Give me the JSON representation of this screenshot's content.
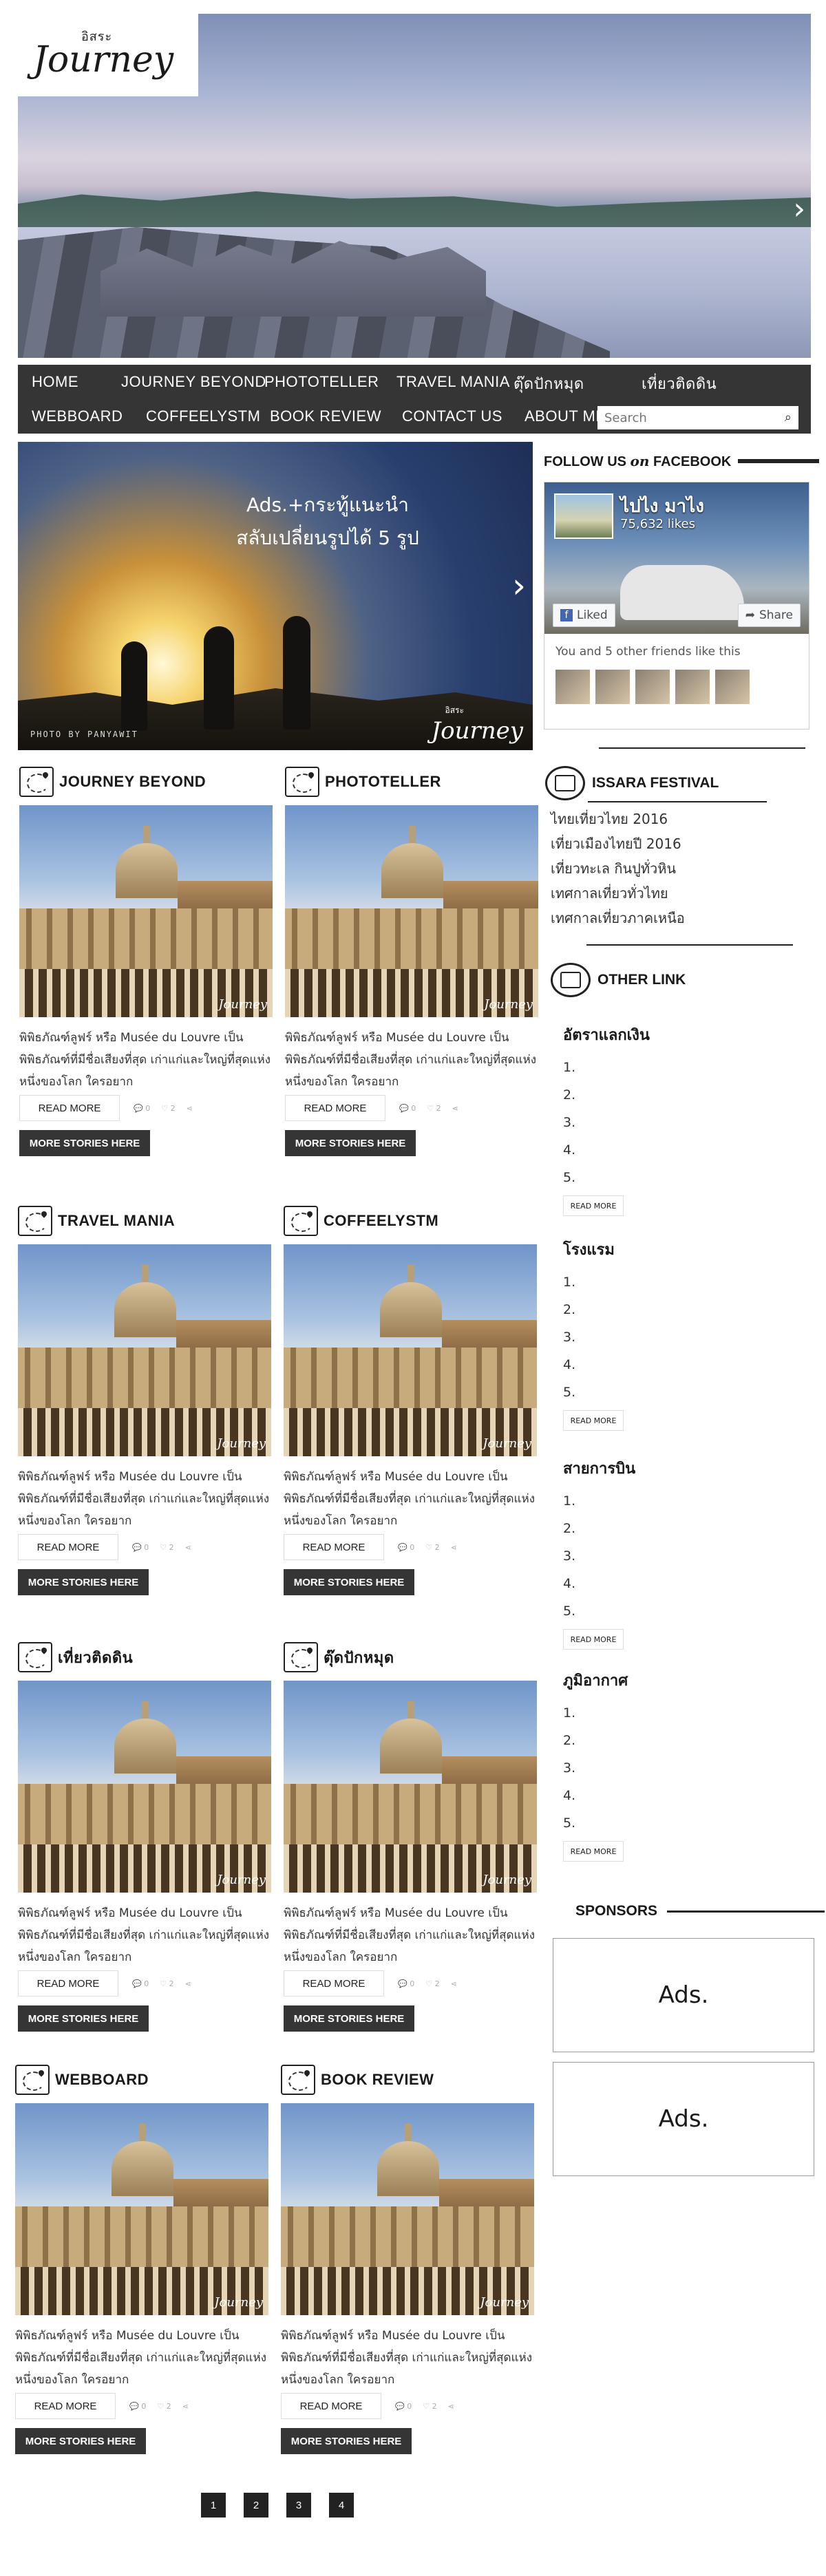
{
  "logo": {
    "small": "อิสระ",
    "main": "Journey"
  },
  "hero": {
    "next_arrow": "›"
  },
  "nav": {
    "row1": [
      "HOME",
      "JOURNEY BEYOND",
      "PHOTOTELLER",
      "TRAVEL MANIA",
      "ตุ๊ดปักหมุด",
      "เที่ยวติดดิน"
    ],
    "row2": [
      "WEBBOARD",
      "COFFEELYSTM",
      "BOOK REVIEW",
      "CONTACT US",
      "ABOUT ME"
    ],
    "search_placeholder": "Search",
    "search_icon": "magnifier-icon"
  },
  "banner": {
    "ad_line1": "Ads.+กระทู้แนะนำ",
    "ad_line2": "สลับเปลี่ยนรูปได้ 5 รูป",
    "credit": "PHOTO BY PANYAWIT",
    "logo_small": "อิสระ",
    "logo_main": "Journey",
    "next_arrow": "›"
  },
  "cards": [
    {
      "title": "JOURNEY BEYOND",
      "desc": "พิพิธภัณฑ์ลูฟร์ หรือ Musée du Louvre เป็นพิพิธภัณฑ์ที่มีชื่อเสียงที่สุด เก่าแก่และใหญ่ที่สุดแห่งหนึ่งของโลก ใครอยาก",
      "read_more": "READ MORE",
      "comments": "0",
      "likes": "2",
      "more": "MORE STORIES HERE",
      "watermark": "Journey"
    },
    {
      "title": "PHOTOTELLER",
      "desc": "พิพิธภัณฑ์ลูฟร์ หรือ Musée du Louvre เป็นพิพิธภัณฑ์ที่มีชื่อเสียงที่สุด เก่าแก่และใหญ่ที่สุดแห่งหนึ่งของโลก ใครอยาก",
      "read_more": "READ MORE",
      "comments": "0",
      "likes": "2",
      "more": "MORE STORIES HERE",
      "watermark": "Journey"
    },
    {
      "title": "TRAVEL MANIA",
      "desc": "พิพิธภัณฑ์ลูฟร์ หรือ Musée du Louvre เป็นพิพิธภัณฑ์ที่มีชื่อเสียงที่สุด เก่าแก่และใหญ่ที่สุดแห่งหนึ่งของโลก ใครอยาก",
      "read_more": "READ MORE",
      "comments": "0",
      "likes": "2",
      "more": "MORE STORIES HERE",
      "watermark": "Journey"
    },
    {
      "title": "COFFEELYSTM",
      "desc": "พิพิธภัณฑ์ลูฟร์ หรือ Musée du Louvre เป็นพิพิธภัณฑ์ที่มีชื่อเสียงที่สุด เก่าแก่และใหญ่ที่สุดแห่งหนึ่งของโลก ใครอยาก",
      "read_more": "READ MORE",
      "comments": "0",
      "likes": "2",
      "more": "MORE STORIES HERE",
      "watermark": "Journey"
    },
    {
      "title": "เที่ยวติดดิน",
      "desc": "พิพิธภัณฑ์ลูฟร์ หรือ Musée du Louvre เป็นพิพิธภัณฑ์ที่มีชื่อเสียงที่สุด เก่าแก่และใหญ่ที่สุดแห่งหนึ่งของโลก ใครอยาก",
      "read_more": "READ MORE",
      "comments": "0",
      "likes": "2",
      "more": "MORE STORIES HERE",
      "watermark": "Journey"
    },
    {
      "title": "ตุ๊ดปักหมุด",
      "desc": "พิพิธภัณฑ์ลูฟร์ หรือ Musée du Louvre เป็นพิพิธภัณฑ์ที่มีชื่อเสียงที่สุด เก่าแก่และใหญ่ที่สุดแห่งหนึ่งของโลก ใครอยาก",
      "read_more": "READ MORE",
      "comments": "0",
      "likes": "2",
      "more": "MORE STORIES HERE",
      "watermark": "Journey"
    },
    {
      "title": "WEBBOARD",
      "desc": "พิพิธภัณฑ์ลูฟร์ หรือ Musée du Louvre เป็นพิพิธภัณฑ์ที่มีชื่อเสียงที่สุด เก่าแก่และใหญ่ที่สุดแห่งหนึ่งของโลก ใครอยาก",
      "read_more": "READ MORE",
      "comments": "0",
      "likes": "2",
      "more": "MORE STORIES HERE",
      "watermark": "Journey"
    },
    {
      "title": "BOOK REVIEW",
      "desc": "พิพิธภัณฑ์ลูฟร์ หรือ Musée du Louvre เป็นพิพิธภัณฑ์ที่มีชื่อเสียงที่สุด เก่าแก่และใหญ่ที่สุดแห่งหนึ่งของโลก ใครอยาก",
      "read_more": "READ MORE",
      "comments": "0",
      "likes": "2",
      "more": "MORE STORIES HERE",
      "watermark": "Journey"
    }
  ],
  "facebook": {
    "heading_prefix": "FOLLOW US",
    "heading_on": "on",
    "heading_suffix": "FACEBOOK",
    "page_name": "ไปไง มาไง",
    "likes": "75,632 likes",
    "liked_btn": "Liked",
    "share_btn": "Share",
    "friends_text": "You and 5 other friends like this"
  },
  "festival": {
    "title": "ISSARA FESTIVAL",
    "items": [
      "ไทยเที่ยวไทย 2016",
      "เที่ยวเมืองไทยปี 2016",
      "เที่ยวทะเล กินปูทั่วหิน",
      "เทศกาลเที่ยวทั่วไทย",
      "เทศกาลเที่ยวภาคเหนือ"
    ]
  },
  "other_link": {
    "title": "OTHER LINK",
    "groups": [
      {
        "title": "อัตราแลกเงิน",
        "items": [
          "1.",
          "2.",
          "3.",
          "4.",
          "5."
        ],
        "more": "READ MORE"
      },
      {
        "title": "โรงแรม",
        "items": [
          "1.",
          "2.",
          "3.",
          "4.",
          "5."
        ],
        "more": "READ MORE"
      },
      {
        "title": "สายการบิน",
        "items": [
          "1.",
          "2.",
          "3.",
          "4.",
          "5."
        ],
        "more": "READ MORE"
      },
      {
        "title": "ภูมิอากาศ",
        "items": [
          "1.",
          "2.",
          "3.",
          "4.",
          "5."
        ],
        "more": "READ MORE"
      }
    ]
  },
  "sponsors": {
    "title": "SPONSORS",
    "ads": [
      "Ads.",
      "Ads."
    ]
  },
  "pagination": [
    "1",
    "2",
    "3",
    "4"
  ]
}
